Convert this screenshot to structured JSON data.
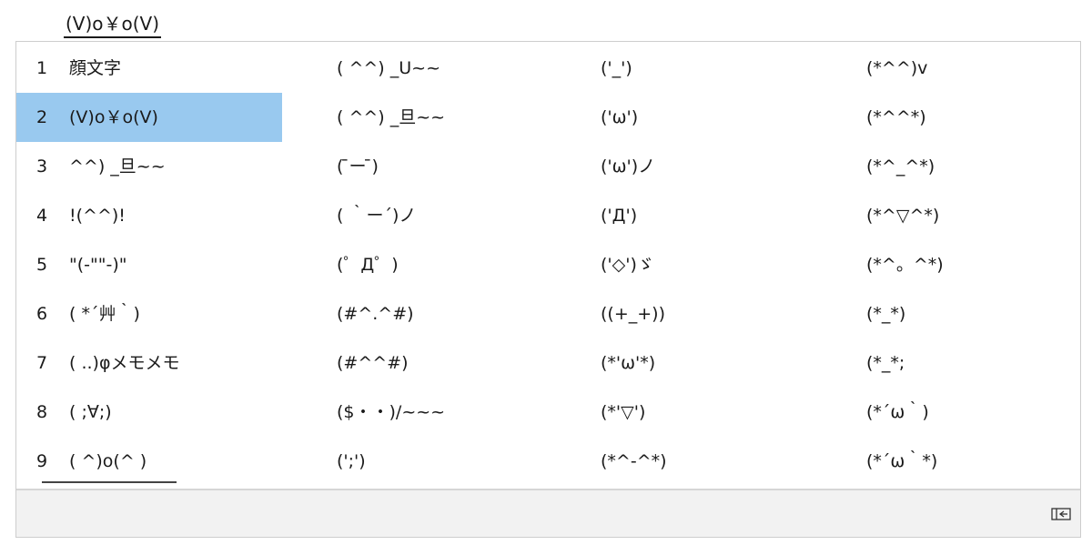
{
  "composition": {
    "text": "(V)o￥o(V)"
  },
  "candidates": {
    "columns": [
      [
        {
          "num": "1",
          "text": "顔文字"
        },
        {
          "num": "2",
          "text": "(V)o￥o(V)"
        },
        {
          "num": "3",
          "text": " ^^) _旦~~"
        },
        {
          "num": "4",
          "text": "!(^^)!"
        },
        {
          "num": "5",
          "text": "\"(-\"\"-)\""
        },
        {
          "num": "6",
          "text": "( *´艸｀)"
        },
        {
          "num": "7",
          "text": "( ..)φメモメモ"
        },
        {
          "num": "8",
          "text": "( ;∀;)"
        },
        {
          "num": "9",
          "text": "( ^)o(^ )"
        }
      ],
      [
        {
          "text": "( ^^) _U~~"
        },
        {
          "text": "( ^^) _旦~~"
        },
        {
          "text": "( ̄ー ̄)"
        },
        {
          "text": "( ｀ー´)ノ"
        },
        {
          "text": "(゜Д゜)"
        },
        {
          "text": "(#^.^#)"
        },
        {
          "text": "(#^^#)"
        },
        {
          "text": "($・・)/~~~"
        },
        {
          "text": "(';')"
        }
      ],
      [
        {
          "text": "('_')"
        },
        {
          "text": "('ω')"
        },
        {
          "text": "('ω')ノ"
        },
        {
          "text": "('Д')"
        },
        {
          "text": "('◇')ゞ"
        },
        {
          "text": "((+_+))"
        },
        {
          "text": "(*'ω'*)"
        },
        {
          "text": "(*'▽')"
        },
        {
          "text": "(*^-^*)"
        }
      ],
      [
        {
          "text": "(*^^)v"
        },
        {
          "text": "(*^^*)"
        },
        {
          "text": "(*^_^*)"
        },
        {
          "text": "(*^▽^*)"
        },
        {
          "text": "(*^。^*)"
        },
        {
          "text": "(*_*)"
        },
        {
          "text": "(*_*;"
        },
        {
          "text": "(*´ω｀)"
        },
        {
          "text": "(*´ω｀*)"
        }
      ]
    ],
    "selected_index": 1
  },
  "footer": {
    "expand_icon": "expand-table-icon"
  },
  "colors": {
    "selection": "#99c9ef",
    "footer_bg": "#f2f2f2",
    "border": "#cdcdcd"
  }
}
